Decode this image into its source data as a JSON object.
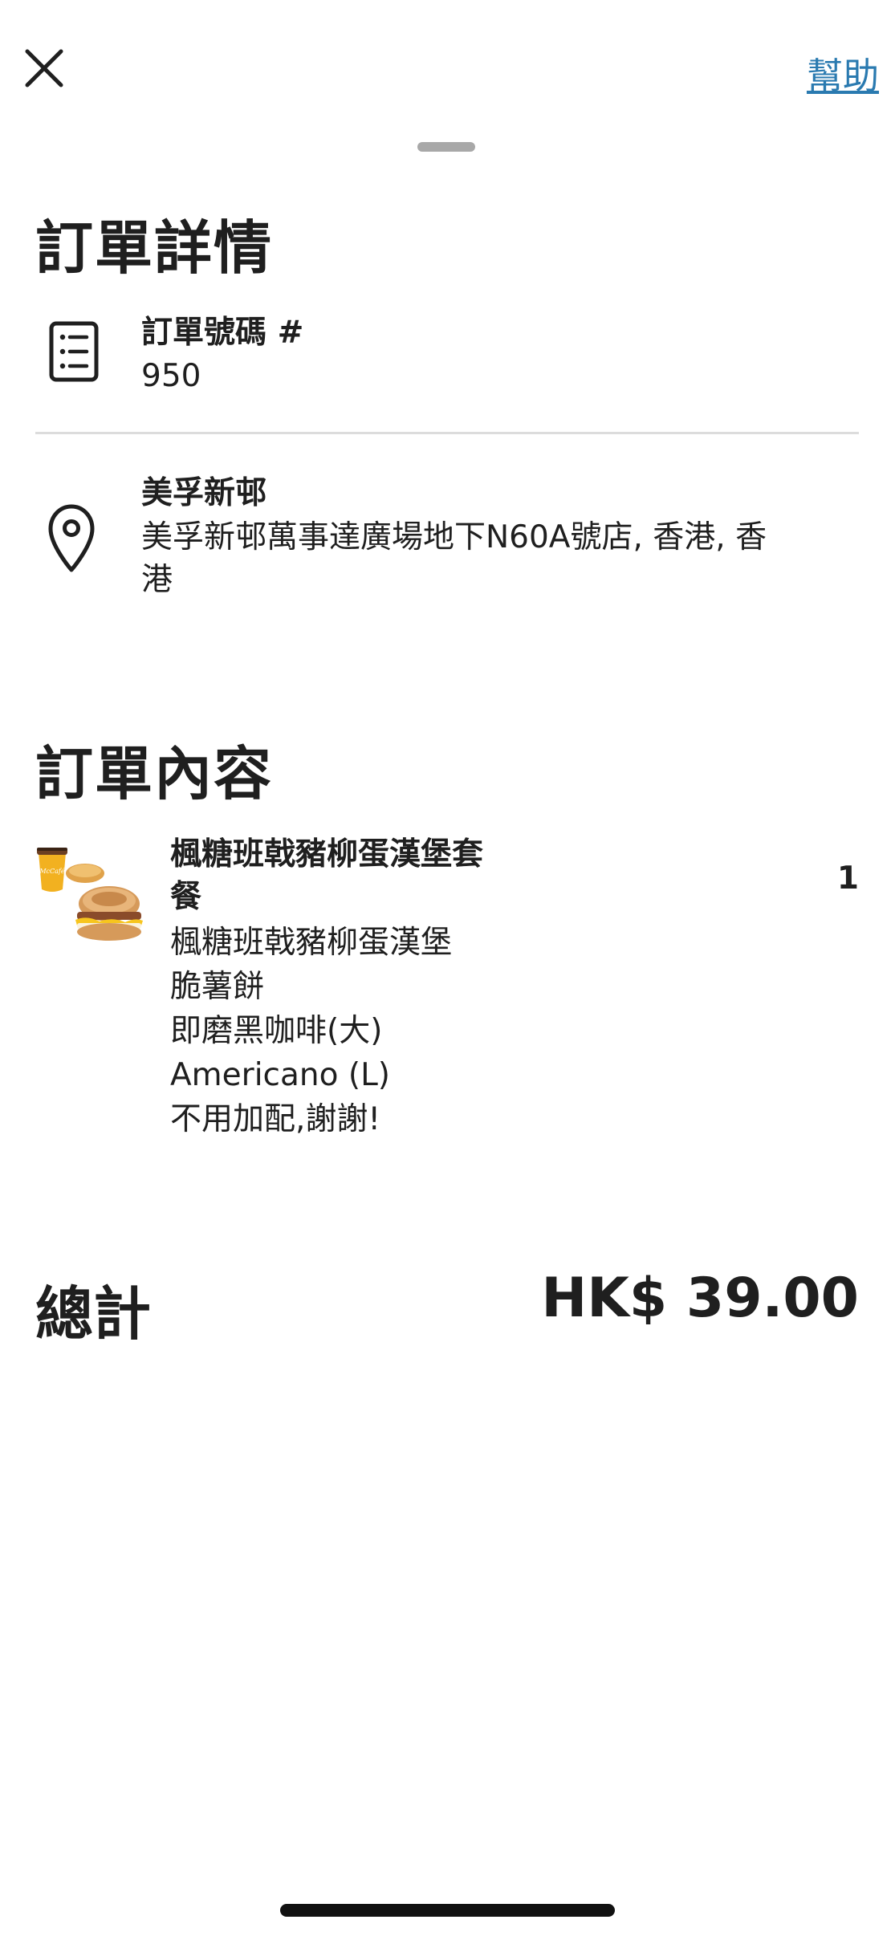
{
  "header": {
    "close_icon": "close-icon",
    "help_label": "幫助"
  },
  "details": {
    "title": "訂單詳情",
    "order_label": "訂單號碼 #",
    "order_number": "950",
    "receipt_icon": "receipt-icon",
    "pin_icon": "location-pin-icon",
    "store_name": "美孚新邨",
    "store_address": "美孚新邨萬事達廣場地下N60A號店, 香港, 香港"
  },
  "contents": {
    "title": "訂單內容",
    "item": {
      "name": "楓糖班戟豬柳蛋漢堡套餐",
      "quantity": "1",
      "options": [
        "楓糖班戟豬柳蛋漢堡",
        "脆薯餅",
        "即磨黑咖啡(大)",
        "Americano (L)",
        "不用加配,謝謝!"
      ],
      "image_cup_text": "McCafé"
    }
  },
  "total": {
    "label": "總計",
    "value": "HK$ 39.00"
  },
  "colors": {
    "link": "#2a7ab0",
    "text": "#1f1f1f",
    "divider": "#dcdcdc"
  }
}
